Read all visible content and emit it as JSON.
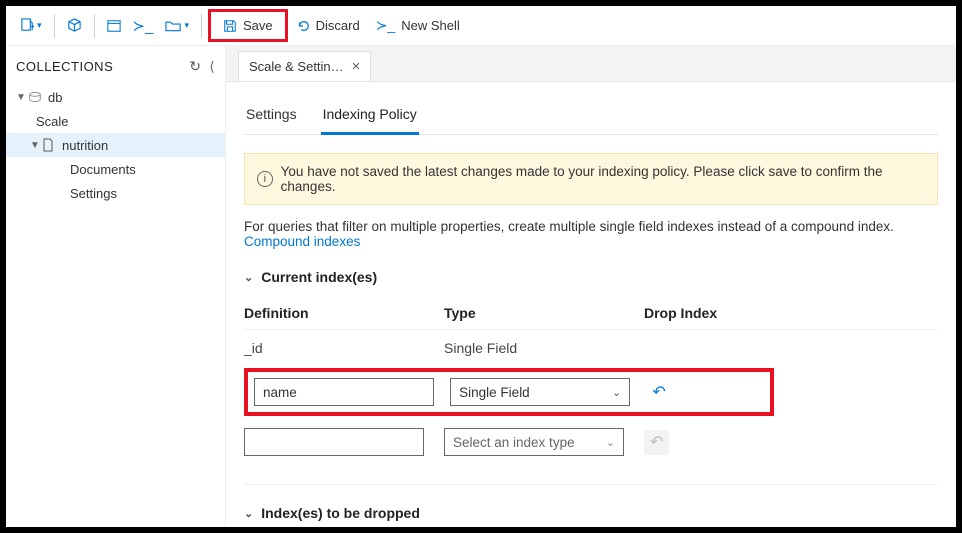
{
  "toolbar": {
    "save_label": "Save",
    "discard_label": "Discard",
    "newshell_label": "New Shell"
  },
  "sidebar": {
    "title": "COLLECTIONS",
    "db": "db",
    "scale": "Scale",
    "nutrition": "nutrition",
    "documents": "Documents",
    "settings": "Settings"
  },
  "filetab": {
    "label": "Scale & Settin…"
  },
  "subtabs": {
    "settings": "Settings",
    "indexing": "Indexing Policy"
  },
  "banner": {
    "text": "You have not saved the latest changes made to your indexing policy. Please click save to confirm the changes."
  },
  "help": {
    "text": "For queries that filter on multiple properties, create multiple single field indexes instead of a compound index. ",
    "link": "Compound indexes"
  },
  "sections": {
    "current": "Current index(es)",
    "drop": "Index(es) to be dropped"
  },
  "table": {
    "head_def": "Definition",
    "head_type": "Type",
    "head_drop": "Drop Index",
    "row0_def": "_id",
    "row0_type": "Single Field",
    "row1_def": "name",
    "row1_type": "Single Field",
    "row2_def": "",
    "row2_type_ph": "Select an index type"
  }
}
